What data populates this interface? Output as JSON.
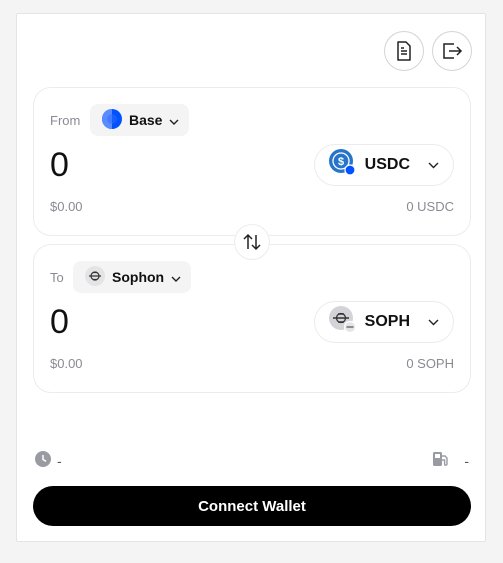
{
  "header": {
    "icons": [
      "document-icon",
      "logout-icon"
    ]
  },
  "from": {
    "label": "From",
    "chain": "Base",
    "amount": "0",
    "token": "USDC",
    "usd_value": "$0.00",
    "balance": "0 USDC"
  },
  "to": {
    "label": "To",
    "chain": "Sophon",
    "amount": "0",
    "token": "SOPH",
    "usd_value": "$0.00",
    "balance": "0 SOPH"
  },
  "info": {
    "time_value": "-",
    "gas_value": "-"
  },
  "connect_label": "Connect Wallet",
  "colors": {
    "usdc": "#2775ca",
    "base": "#0052ff",
    "button": "#000000"
  }
}
